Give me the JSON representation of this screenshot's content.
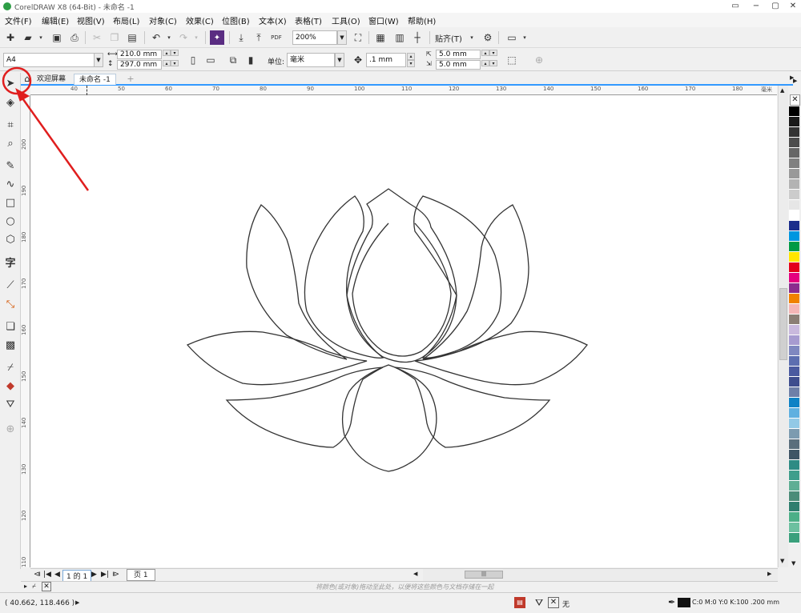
{
  "window": {
    "title": "CorelDRAW X8 (64-Bit) - 未命名 -1",
    "minimize_label": "−",
    "restore_label": "▢",
    "close_label": "✕"
  },
  "menu": [
    "文件(F)",
    "编辑(E)",
    "视图(V)",
    "布局(L)",
    "对象(C)",
    "效果(C)",
    "位图(B)",
    "文本(X)",
    "表格(T)",
    "工具(O)",
    "窗口(W)",
    "帮助(H)"
  ],
  "standard_toolbar": {
    "zoom_value": "200%",
    "snap_label": "贴齐(T)",
    "pdf_label": "PDF"
  },
  "property_bar": {
    "page_size": "A4",
    "width": "210.0 mm",
    "height": "297.0 mm",
    "units_label": "单位:",
    "units_value": "毫米",
    "nudge": ".1 mm",
    "dup_x": "5.0 mm",
    "dup_y": "5.0 mm"
  },
  "tabs": [
    {
      "label": "欢迎屏幕",
      "active": false
    },
    {
      "label": "未命名 -1",
      "active": true
    }
  ],
  "ruler": {
    "h_ticks": [
      "40",
      "50",
      "60",
      "70",
      "80",
      "90",
      "100",
      "110",
      "120",
      "130",
      "140",
      "150",
      "160",
      "170",
      "180"
    ],
    "h_unit": "毫米",
    "v_ticks": [
      "200",
      "190",
      "180",
      "170",
      "160",
      "150",
      "140",
      "130",
      "120",
      "110"
    ]
  },
  "palette_colors": [
    "#000000",
    "#1a1a1a",
    "#333333",
    "#4d4d4d",
    "#666666",
    "#808080",
    "#999999",
    "#b3b3b3",
    "#cccccc",
    "#e6e6e6",
    "#ffffff",
    "#1b2e8c",
    "#0096e0",
    "#009a44",
    "#ffe600",
    "#e3001b",
    "#e4007f",
    "#8a2c8e",
    "#f08200",
    "#f4b6b6",
    "#8b7e74",
    "#c9b9dd",
    "#a79bd0",
    "#7f88c0",
    "#5c6eb0",
    "#4a5aa0",
    "#3e4d8e",
    "#6e7fa8",
    "#0e82c5",
    "#5fb0e0",
    "#92c9e6",
    "#7c9bb0",
    "#5a6e7c",
    "#3f5566",
    "#2e8b84",
    "#3f9e8c",
    "#5fae94",
    "#4a8c78",
    "#2f7f6f",
    "#4caf88",
    "#6cc0a0",
    "#3aa07c"
  ],
  "page_nav": {
    "page_of": "1 的 1",
    "page_tab": "页 1"
  },
  "hint_text": "将颜色(或对象)拖动至此处，以便将这些颜色与文档存储在一起",
  "status": {
    "coords": "( 40.662, 118.466 )",
    "fill_none": "无",
    "outline_info": "C:0 M:0 Y:0 K:100  .200 mm"
  }
}
